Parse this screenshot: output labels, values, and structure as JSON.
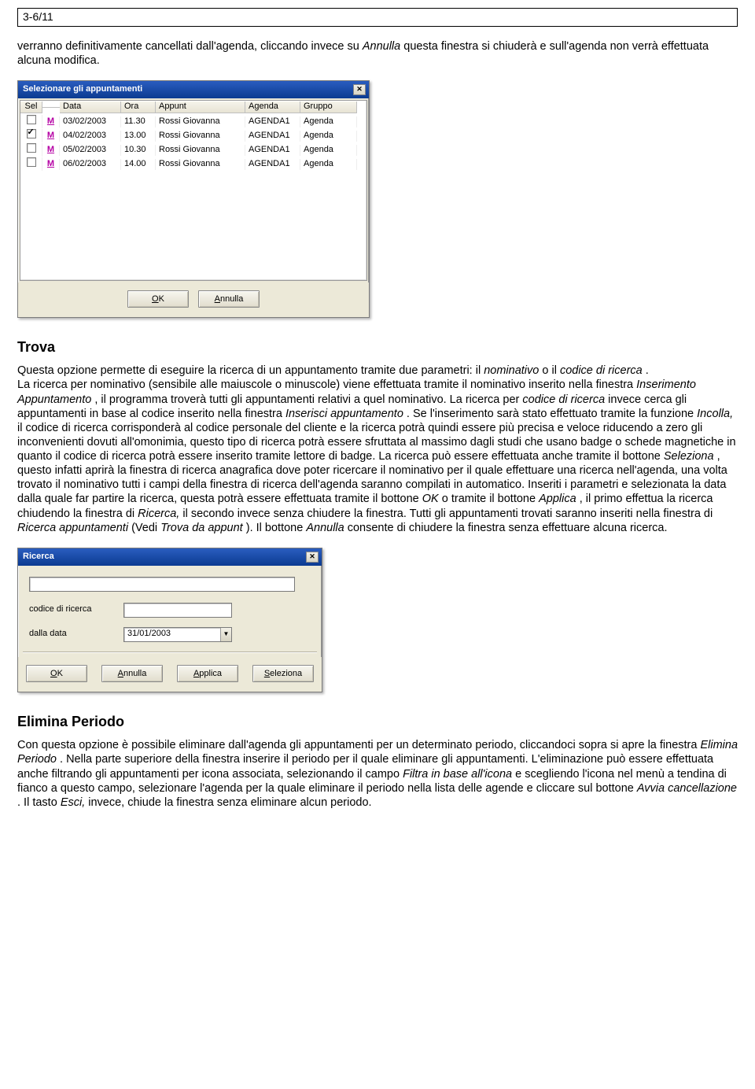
{
  "page_header": "3-6/11",
  "intro_para_parts": {
    "p1": "verranno definitivamente cancellati dall'agenda, cliccando invece su ",
    "p2": "Annulla",
    "p3": " questa finestra si chiuderà e sull'agenda non verrà effettuata alcuna modifica."
  },
  "sel_dialog": {
    "title": "Selezionare gli appuntamenti",
    "headers": {
      "sel": "Sel",
      "data": "Data",
      "ora": "Ora",
      "appunt": "Appunt",
      "agenda": "Agenda",
      "gruppo": "Gruppo"
    },
    "rows": [
      {
        "checked": false,
        "m": "M",
        "data": "03/02/2003",
        "ora": "11.30",
        "appunt": "Rossi Giovanna",
        "agenda": "AGENDA1",
        "gruppo": "Agenda"
      },
      {
        "checked": true,
        "m": "M",
        "data": "04/02/2003",
        "ora": "13.00",
        "appunt": "Rossi Giovanna",
        "agenda": "AGENDA1",
        "gruppo": "Agenda"
      },
      {
        "checked": false,
        "m": "M",
        "data": "05/02/2003",
        "ora": "10.30",
        "appunt": "Rossi Giovanna",
        "agenda": "AGENDA1",
        "gruppo": "Agenda"
      },
      {
        "checked": false,
        "m": "M",
        "data": "06/02/2003",
        "ora": "14.00",
        "appunt": "Rossi Giovanna",
        "agenda": "AGENDA1",
        "gruppo": "Agenda"
      }
    ],
    "buttons": {
      "ok_u": "O",
      "ok_rest": "K",
      "ann_u": "A",
      "ann_rest": "nnulla"
    }
  },
  "trova": {
    "title": "Trova",
    "p": {
      "a1": "Questa opzione permette di eseguire la ricerca di un appuntamento tramite due parametri: il ",
      "a2": "nominativo",
      "a3": " o il ",
      "a4": "codice di ricerca",
      "a5": " .",
      "b1": "La ricerca per nominativo (sensibile alle maiuscole o minuscole) viene effettuata tramite il nominativo inserito nella finestra ",
      "b2": "Inserimento Appuntamento",
      "b3": ", il programma troverà tutti gli appuntamenti relativi a quel nominativo. La ricerca per ",
      "b4": "codice di ricerca",
      "b5": " invece cerca gli appuntamenti in base al codice inserito nella finestra ",
      "b6": "Inserisci appuntamento",
      "b7": ". Se l'inserimento sarà stato effettuato tramite la funzione ",
      "b8": "Incolla,",
      "b9": " il codice di ricerca corrisponderà al codice personale del cliente e la ricerca potrà quindi essere più precisa e veloce riducendo a zero gli inconvenienti dovuti all'omonimia, questo tipo di ricerca potrà essere sfruttata al massimo dagli studi che usano badge o schede magnetiche in quanto il codice di ricerca potrà essere inserito tramite lettore di badge. La ricerca può essere effettuata anche tramite il bottone ",
      "b10": "Seleziona",
      "b11": ", questo infatti aprirà la finestra di ricerca anagrafica dove poter ricercare il nominativo per il quale effettuare una ricerca nell'agenda, una volta trovato il nominativo tutti i campi della finestra di ricerca dell'agenda saranno compilati in automatico. Inseriti i parametri e selezionata la data dalla quale far partire la ricerca, questa potrà essere effettuata tramite il bottone ",
      "b12": "OK",
      "b13": " o tramite il bottone ",
      "b14": "Applica",
      "b15": ", il primo effettua la ricerca chiudendo la finestra di ",
      "b16": "Ricerca,",
      "b17": " il secondo invece senza chiudere la finestra. Tutti gli appuntamenti trovati saranno inseriti nella finestra di ",
      "b18": "Ricerca appuntamenti",
      "b19": " (Vedi ",
      "b20": "Trova da appunt",
      "b21": " ). Il bottone ",
      "b22": "Annulla",
      "b23": " consente di chiudere la finestra senza effettuare alcuna ricerca."
    }
  },
  "ricerca_dialog": {
    "title": "Ricerca",
    "labels": {
      "codice": "codice di ricerca",
      "dalla": "dalla data"
    },
    "date_value": "31/01/2003",
    "buttons": {
      "ok_u": "O",
      "ok_r": "K",
      "an_u": "A",
      "an_r": "nnulla",
      "ap_u": "A",
      "ap_r": "pplica",
      "se_u": "S",
      "se_r": "eleziona"
    }
  },
  "elimina": {
    "title": "Elimina Periodo",
    "p": {
      "a1": "Con questa opzione è possibile eliminare dall'agenda gli appuntamenti per un determinato periodo, cliccandoci sopra si apre la finestra ",
      "a2": "Elimina Periodo",
      "a3": ". Nella parte superiore della finestra inserire il periodo per il quale eliminare gli appuntamenti. L'eliminazione può essere effettuata anche filtrando gli appuntamenti per icona associata, selezionando il campo ",
      "a4": "Filtra in base all'icona",
      "a5": " e scegliendo l'icona nel menù a tendina di fianco a questo campo, selezionare l'agenda per la quale eliminare il periodo nella lista delle agende e cliccare sul bottone ",
      "a6": "Avvia cancellazione",
      "a7": ". Il tasto ",
      "a8": "Esci,",
      "a9": " invece, chiude la finestra senza eliminare alcun periodo."
    }
  }
}
